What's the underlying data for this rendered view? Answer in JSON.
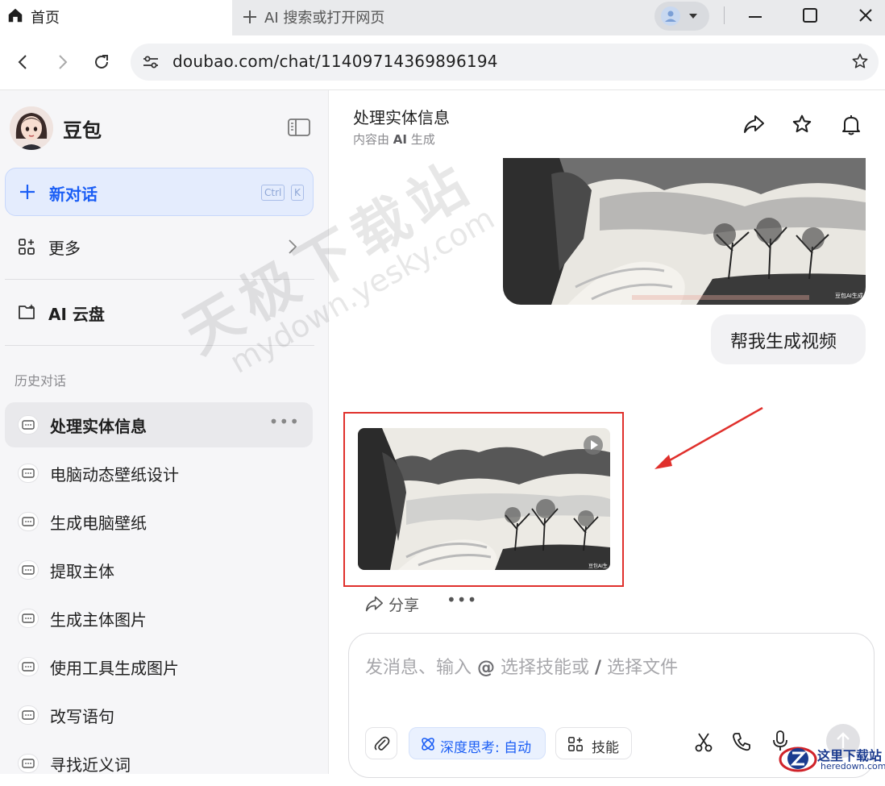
{
  "browser": {
    "active_tab_title": "首页",
    "new_tab_label": "AI 搜索或打开网页",
    "url": "doubao.com/chat/11409714369896194"
  },
  "sidebar": {
    "brand": "豆包",
    "new_chat": {
      "label": "新对话",
      "shortcut": [
        "Ctrl",
        "K"
      ]
    },
    "more_label": "更多",
    "cloud_label": "AI 云盘",
    "history_title": "历史对话",
    "history": [
      {
        "label": "处理实体信息",
        "active": true
      },
      {
        "label": "电脑动态壁纸设计"
      },
      {
        "label": "生成电脑壁纸"
      },
      {
        "label": "提取主体"
      },
      {
        "label": "生成主体图片"
      },
      {
        "label": "使用工具生成图片"
      },
      {
        "label": "改写语句"
      },
      {
        "label": "寻找近义词"
      }
    ]
  },
  "chat": {
    "title": "处理实体信息",
    "subtitle_prefix": "内容由",
    "subtitle_bold": "AI",
    "subtitle_suffix": "生成",
    "image_caption": "豆包AI生成",
    "user_message": "帮我生成视频",
    "share_label": "分享"
  },
  "composer": {
    "placeholder_1": "发消息、输入",
    "placeholder_at": "@",
    "placeholder_2": "选择技能或",
    "placeholder_slash": "/",
    "placeholder_3": "选择文件",
    "deep_think_label": "深度思考: 自动",
    "skills_label": "技能"
  },
  "watermark": {
    "line1": "天极下载站",
    "line2": "mydown.yesky.com"
  },
  "corner_logo": {
    "line1": "这里下载站",
    "line2": "heredown.com"
  },
  "colors": {
    "accent": "#1b5ef5",
    "highlight_border": "#e0302c",
    "sidebar_bg": "#f6f6f8"
  }
}
